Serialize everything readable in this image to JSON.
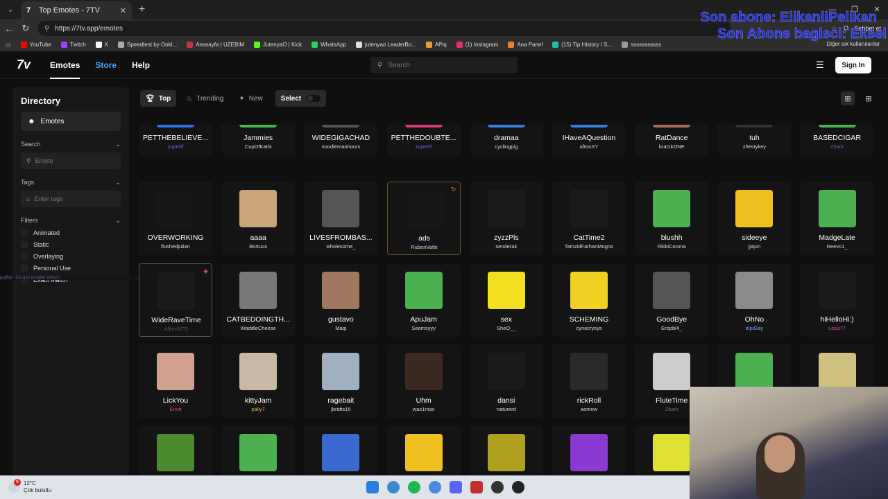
{
  "browser": {
    "tab_title": "Top Emotes - 7TV",
    "url": "https://7tv.app/emotes",
    "chat_label": "Sohbet et",
    "bookmarks": [
      {
        "label": "YouTube",
        "color": "#ff0000"
      },
      {
        "label": "Twitch",
        "color": "#9146ff"
      },
      {
        "label": "X",
        "color": "#ffffff"
      },
      {
        "label": "Speedtest by Ookl...",
        "color": "#aaaaaa"
      },
      {
        "label": "Anasayfa | UZEBIM",
        "color": "#cc3344"
      },
      {
        "label": "JutenyaO | Kick",
        "color": "#53fc18"
      },
      {
        "label": "WhatsApp",
        "color": "#25d366"
      },
      {
        "label": "jutenyao LeaderBo...",
        "color": "#dddddd"
      },
      {
        "label": "APiq",
        "color": "#e0a030"
      },
      {
        "label": "(1) Instagram",
        "color": "#e1306c"
      },
      {
        "label": "Ana Panel",
        "color": "#f08030"
      },
      {
        "label": "(15) Tip History / S...",
        "color": "#20c0a0"
      },
      {
        "label": "sssssssssss",
        "color": "#999999"
      }
    ],
    "other_bookmarks": "Diğer sık kullanılanlar"
  },
  "overlay": {
    "line1": "Son abone: ElikanliPelikan",
    "line2": "Son Abone bagisci: Eksel"
  },
  "header": {
    "logo": "7ᴠ",
    "nav": {
      "emotes": "Emotes",
      "store": "Store",
      "help": "Help"
    },
    "search_placeholder": "Search",
    "signin": "Sign In"
  },
  "sidebar": {
    "title": "Directory",
    "emotes_item": "Emotes",
    "search_label": "Search",
    "emote_placeholder": "Emote",
    "tags_label": "Tags",
    "tags_placeholder": "Enter tags",
    "filters_label": "Filters",
    "filters": [
      "Animated",
      "Static",
      "Overlaying",
      "Personal Use",
      "Exact Match"
    ],
    "tooltip": "patBot : Düzgün emojiler ekleyin"
  },
  "filterbar": {
    "top": "Top",
    "trending": "Trending",
    "new": "New",
    "select": "Select"
  },
  "emotes": [
    {
      "name": "PETTHEBELIEVE...",
      "author": "supertf",
      "author_color": "#8a5cff",
      "color": "#2f6fe0"
    },
    {
      "name": "Jammies",
      "author": "CupOfKathi",
      "author_color": "#dddddd",
      "color": "#4caf50"
    },
    {
      "name": "WIDEGIGACHAD",
      "author": "noodlemanhours",
      "author_color": "#dddddd",
      "color": "#555555"
    },
    {
      "name": "PETTHEDOUBTE...",
      "author": "supertf",
      "author_color": "#8a5cff",
      "color": "#d9387a"
    },
    {
      "name": "dramaa",
      "author": "cyclingpig",
      "author_color": "#dddddd",
      "color": "#3a7de0"
    },
    {
      "name": "IHaveAQuestion",
      "author": "aftonXY",
      "author_color": "#dddddd",
      "color": "#3a7de0"
    },
    {
      "name": "RatDance",
      "author": "brat1kONE",
      "author_color": "#dddddd",
      "color": "#a86b5a"
    },
    {
      "name": "tuh",
      "author": "zhestykey",
      "author_color": "#dddddd",
      "color": "#333333"
    },
    {
      "name": "BASEDCIGAR",
      "author": "Zhark",
      "author_color": "#6a6a9a",
      "color": "#4caf50"
    },
    {
      "name": "OVERWORKING",
      "author": "flushedjulian",
      "author_color": "#dddddd",
      "color": "#161616"
    },
    {
      "name": "aaaa",
      "author": "Bortuus",
      "author_color": "#dddddd",
      "color": "#c9a37a"
    },
    {
      "name": "LIVESFROMBAS...",
      "author": "wholesome_",
      "author_color": "#dddddd",
      "color": "#555555"
    },
    {
      "name": "ads",
      "author": "RubenVatle",
      "author_color": "#dddddd",
      "color": "#161616"
    },
    {
      "name": "zyzzPls",
      "author": "senderak",
      "author_color": "#dddddd",
      "color": "#1a1a1a"
    },
    {
      "name": "CatTime2",
      "author": "TamzidFarhanMogno",
      "author_color": "#dddddd",
      "color": "#1a1a1a"
    },
    {
      "name": "blushh",
      "author": "RikkiCorona",
      "author_color": "#dddddd",
      "color": "#4caf50"
    },
    {
      "name": "sideeye",
      "author": "jjajun",
      "author_color": "#dddddd",
      "color": "#f0c020"
    },
    {
      "name": "MadgeLate",
      "author": "Reevo1_",
      "author_color": "#dddddd",
      "color": "#4caf50"
    },
    {
      "name": "WideRaveTime",
      "author": "AlbertXTD",
      "author_color": "#555555",
      "color": "#1a1a1a"
    },
    {
      "name": "CATBEDOINGTH...",
      "author": "WaddleCheese",
      "author_color": "#dddddd",
      "color": "#777777"
    },
    {
      "name": "gustavo",
      "author": "Maqi",
      "author_color": "#dddddd",
      "color": "#a07860"
    },
    {
      "name": "ApuJam",
      "author": "Seemsyyy",
      "author_color": "#dddddd",
      "color": "#4caf50"
    },
    {
      "name": "sex",
      "author": "SheO__",
      "author_color": "#dddddd",
      "color": "#f0e020"
    },
    {
      "name": "SCHEMING",
      "author": "cynocrysys",
      "author_color": "#dddddd",
      "color": "#f0d020"
    },
    {
      "name": "GoodBye",
      "author": "Eropbl4_",
      "author_color": "#dddddd",
      "color": "#555555"
    },
    {
      "name": "OhNo",
      "author": "eljuGay",
      "author_color": "#7ab0ff",
      "color": "#8a8a8a"
    },
    {
      "name": "hiHelloHi:)",
      "author": "Lopa77",
      "author_color": "#d04aa0",
      "color": "#1a1a1a"
    },
    {
      "name": "LickYou",
      "author": "Envtt",
      "author_color": "#e05050",
      "color": "#d0a090"
    },
    {
      "name": "kittyJam",
      "author": "pally7",
      "author_color": "#e0b040",
      "color": "#c8b8a8"
    },
    {
      "name": "ragebait",
      "author": "jbridts15",
      "author_color": "#dddddd",
      "color": "#a0b0c0"
    },
    {
      "name": "Uhm",
      "author": "was1max",
      "author_color": "#dddddd",
      "color": "#3a2a20"
    },
    {
      "name": "dansi",
      "author": "naturerd",
      "author_color": "#dddddd",
      "color": "#1a1a1a"
    },
    {
      "name": "rickRoll",
      "author": "aomow",
      "author_color": "#dddddd",
      "color": "#2a2a2a"
    },
    {
      "name": "FluteTime",
      "author": "Zhark",
      "author_color": "#6a6a9a",
      "color": "#cccccc"
    },
    {
      "name": "",
      "author": "",
      "author_color": "#dddddd",
      "color": "#4caf50"
    },
    {
      "name": "",
      "author": "",
      "author_color": "#dddddd",
      "color": "#d0c080"
    },
    {
      "name": "",
      "author": "",
      "author_color": "#dddddd",
      "color": "#4c8a30"
    },
    {
      "name": "",
      "author": "",
      "author_color": "#dddddd",
      "color": "#4caf50"
    },
    {
      "name": "",
      "author": "",
      "author_color": "#dddddd",
      "color": "#3a6ad0"
    },
    {
      "name": "",
      "author": "",
      "author_color": "#dddddd",
      "color": "#f0c020"
    },
    {
      "name": "",
      "author": "",
      "author_color": "#dddddd",
      "color": "#b0a020"
    },
    {
      "name": "",
      "author": "",
      "author_color": "#dddddd",
      "color": "#8a3ad0"
    },
    {
      "name": "",
      "author": "",
      "author_color": "#dddddd",
      "color": "#e0e030"
    }
  ],
  "taskbar": {
    "temp": "12°C",
    "weather": "Çok bulutlu",
    "notif_count": "6"
  }
}
